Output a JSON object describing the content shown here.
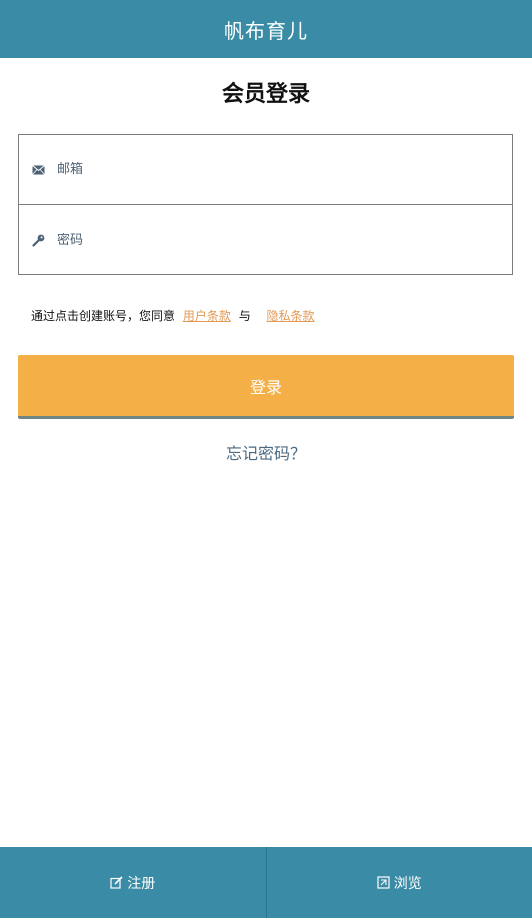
{
  "header": {
    "title": "帆布育儿"
  },
  "page_title": "会员登录",
  "form": {
    "email_placeholder": "邮箱",
    "password_placeholder": "密码",
    "email_icon": "envelope-icon",
    "password_icon": "key-icon"
  },
  "terms": {
    "prefix": "通过点击创建账号，您同意",
    "user_terms": "用户条款",
    "and": "与",
    "privacy_terms": "隐私条款"
  },
  "login_button": "登录",
  "forgot_password": "忘记密码？",
  "bottom_nav": {
    "register_label": "注册",
    "register_icon": "edit-icon",
    "browse_label": "浏览",
    "browse_icon": "browse-icon"
  },
  "colors": {
    "primary": "#3a8ca6",
    "accent": "#f4b047",
    "link": "#e29a55"
  }
}
